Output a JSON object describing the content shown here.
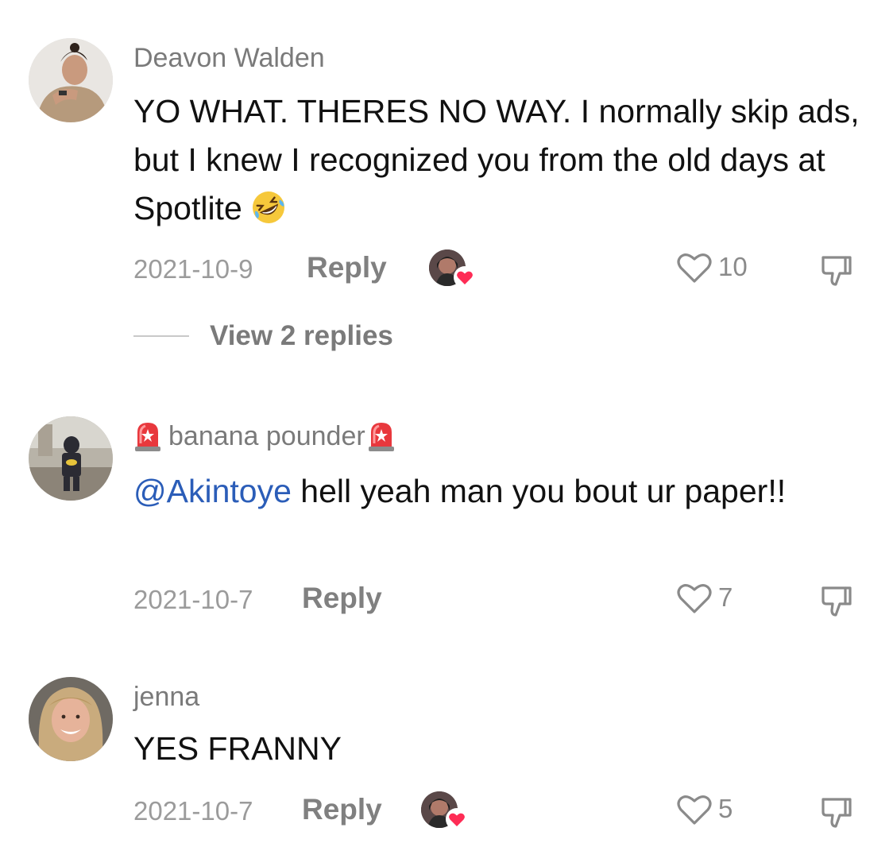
{
  "comments": [
    {
      "username": "Deavon Walden",
      "text": "YO WHAT. THERES NO WAY. I normally skip ads, but I knew I recognized you from the old days at Spotlite",
      "emoji": "rolling-on-floor-laughing",
      "date": "2021-10-9",
      "reply_label": "Reply",
      "likes": "10",
      "liked_by_creator": true,
      "view_replies": "View 2 replies"
    },
    {
      "username": "banana pounder",
      "username_badge_icon": "police-light-icon",
      "mention": "@Akintoye",
      "text": " hell yeah man you bout ur paper!!",
      "date": "2021-10-7",
      "reply_label": "Reply",
      "likes": "7",
      "liked_by_creator": false
    },
    {
      "username": "jenna",
      "text": "YES FRANNY",
      "date": "2021-10-7",
      "reply_label": "Reply",
      "likes": "5",
      "liked_by_creator": true
    }
  ],
  "colors": {
    "mention": "#2b5db8",
    "heart_badge": "#fe2c55",
    "muted_text": "#7a7a7a"
  }
}
